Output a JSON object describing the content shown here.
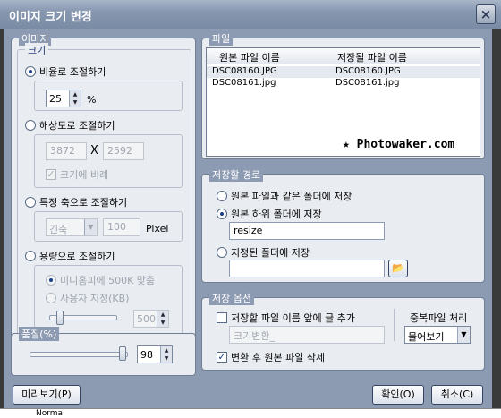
{
  "window": {
    "title": "이미지 크기 변경",
    "close_glyph": "×"
  },
  "image_group": {
    "title": "이미지",
    "size_group": {
      "title": "크기",
      "ratio": {
        "label": "비율로 조절하기",
        "selected": true,
        "value": "25",
        "unit": "%"
      },
      "resolution": {
        "label": "해상도로 조절하기",
        "selected": false,
        "width": "3872",
        "times": "X",
        "height": "2592",
        "keep_ratio_label": "크기에 비례",
        "keep_ratio_checked": true
      },
      "axis": {
        "label": "특정 축으로 조절하기",
        "selected": false,
        "axis_value": "긴축",
        "pixel_value": "100",
        "unit": "Pixel"
      },
      "capacity": {
        "label": "용량으로 조절하기",
        "selected": false,
        "minihome_label": "미니홈피에 500K 맞춤",
        "minihome_selected": true,
        "custom_label": "사용자 지정(KB)",
        "custom_value": "500"
      }
    },
    "quality_group": {
      "title": "품질(%)",
      "value": "98",
      "level": 0.98
    }
  },
  "file_group": {
    "title": "파일",
    "columns": [
      "원본 파일 이름",
      "저장될 파일 이름"
    ],
    "rows": [
      {
        "original": "DSC08160.JPG",
        "saved": "DSC08160.JPG",
        "selected": true
      },
      {
        "original": "DSC08161.jpg",
        "saved": "DSC08161.jpg",
        "selected": false
      }
    ],
    "watermark": "★ Photowaker.com"
  },
  "save_path_group": {
    "title": "저장할 경로",
    "same_folder_label": "원본 파일과 같은 폴더에 저장",
    "sub_folder_label": "원본 하위 폴더에 저장",
    "sub_folder_value": "resize",
    "specified_label": "지정된 폴더에 저장",
    "specified_value": "",
    "selected": "sub_folder"
  },
  "save_options_group": {
    "title": "저장 옵션",
    "prefix_label": "저장할 파일 이름 앞에 글 추가",
    "prefix_checked": false,
    "prefix_value": "크기변환_",
    "duplicate_label": "중복파일 처리",
    "duplicate_value": "물어보기",
    "delete_label": "변환 후 원본 파일 삭제",
    "delete_checked": true
  },
  "buttons": {
    "preview": "미리보기(P)",
    "ok": "확인(O)",
    "cancel": "취소(C)"
  },
  "background_text": "Normal"
}
